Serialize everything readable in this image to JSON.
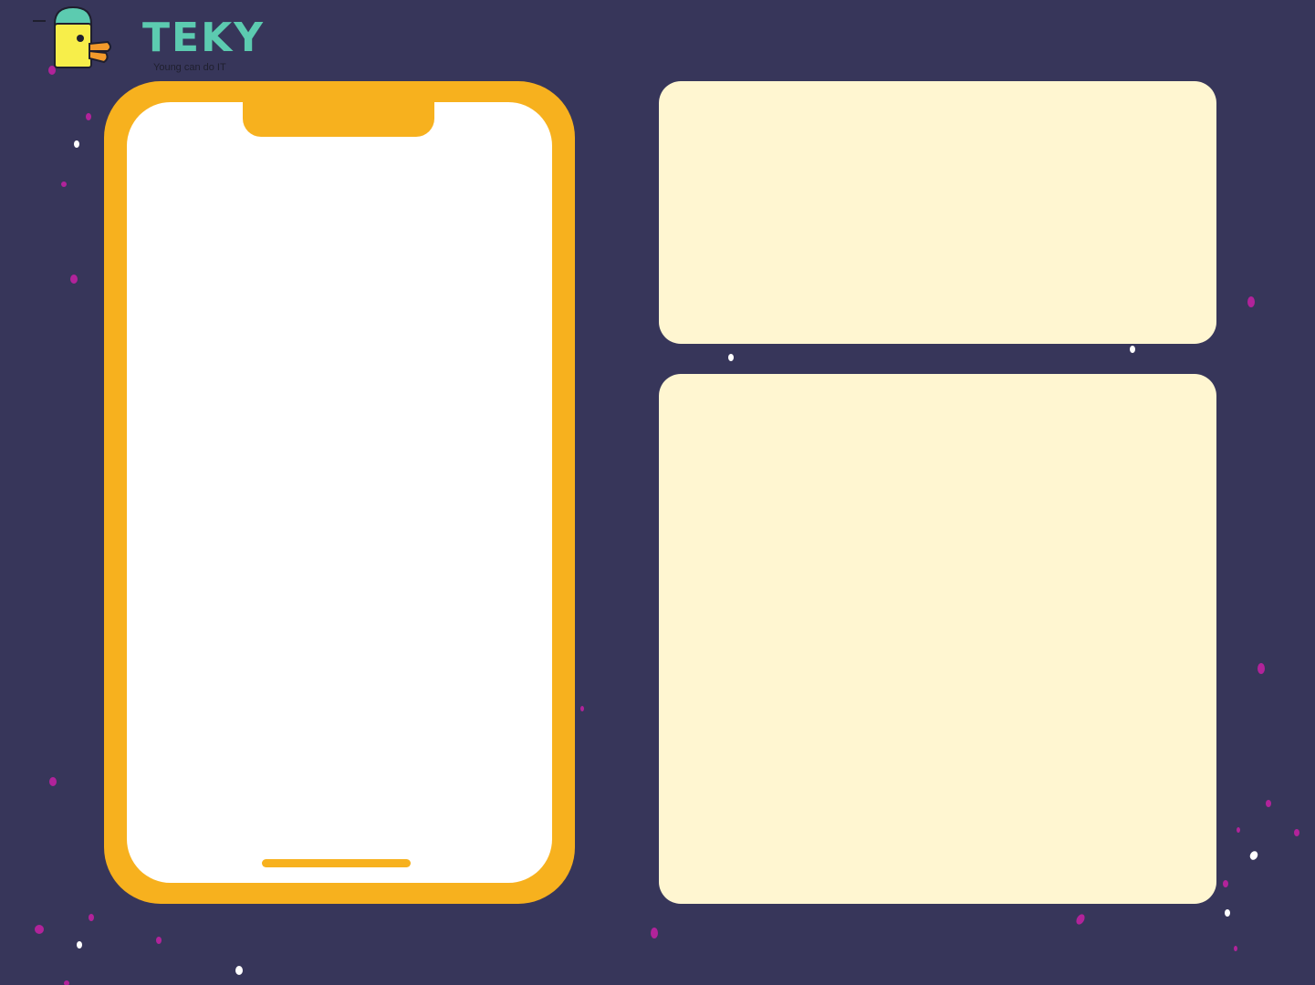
{
  "logo": {
    "word": "TEKY",
    "tagline": "Young can do IT",
    "mascot_icon": "duck-mascot-icon"
  },
  "colors": {
    "background": "#37365a",
    "phone_frame": "#f7b11e",
    "phone_screen": "#ffffff",
    "panel": "#fff6d1",
    "logo_text": "#5ccbb0",
    "dot_white": "#ffffff",
    "dot_purple": "#b1239a"
  },
  "phone": {
    "screen_content": ""
  },
  "panels": [
    {
      "content": ""
    },
    {
      "content": ""
    }
  ]
}
